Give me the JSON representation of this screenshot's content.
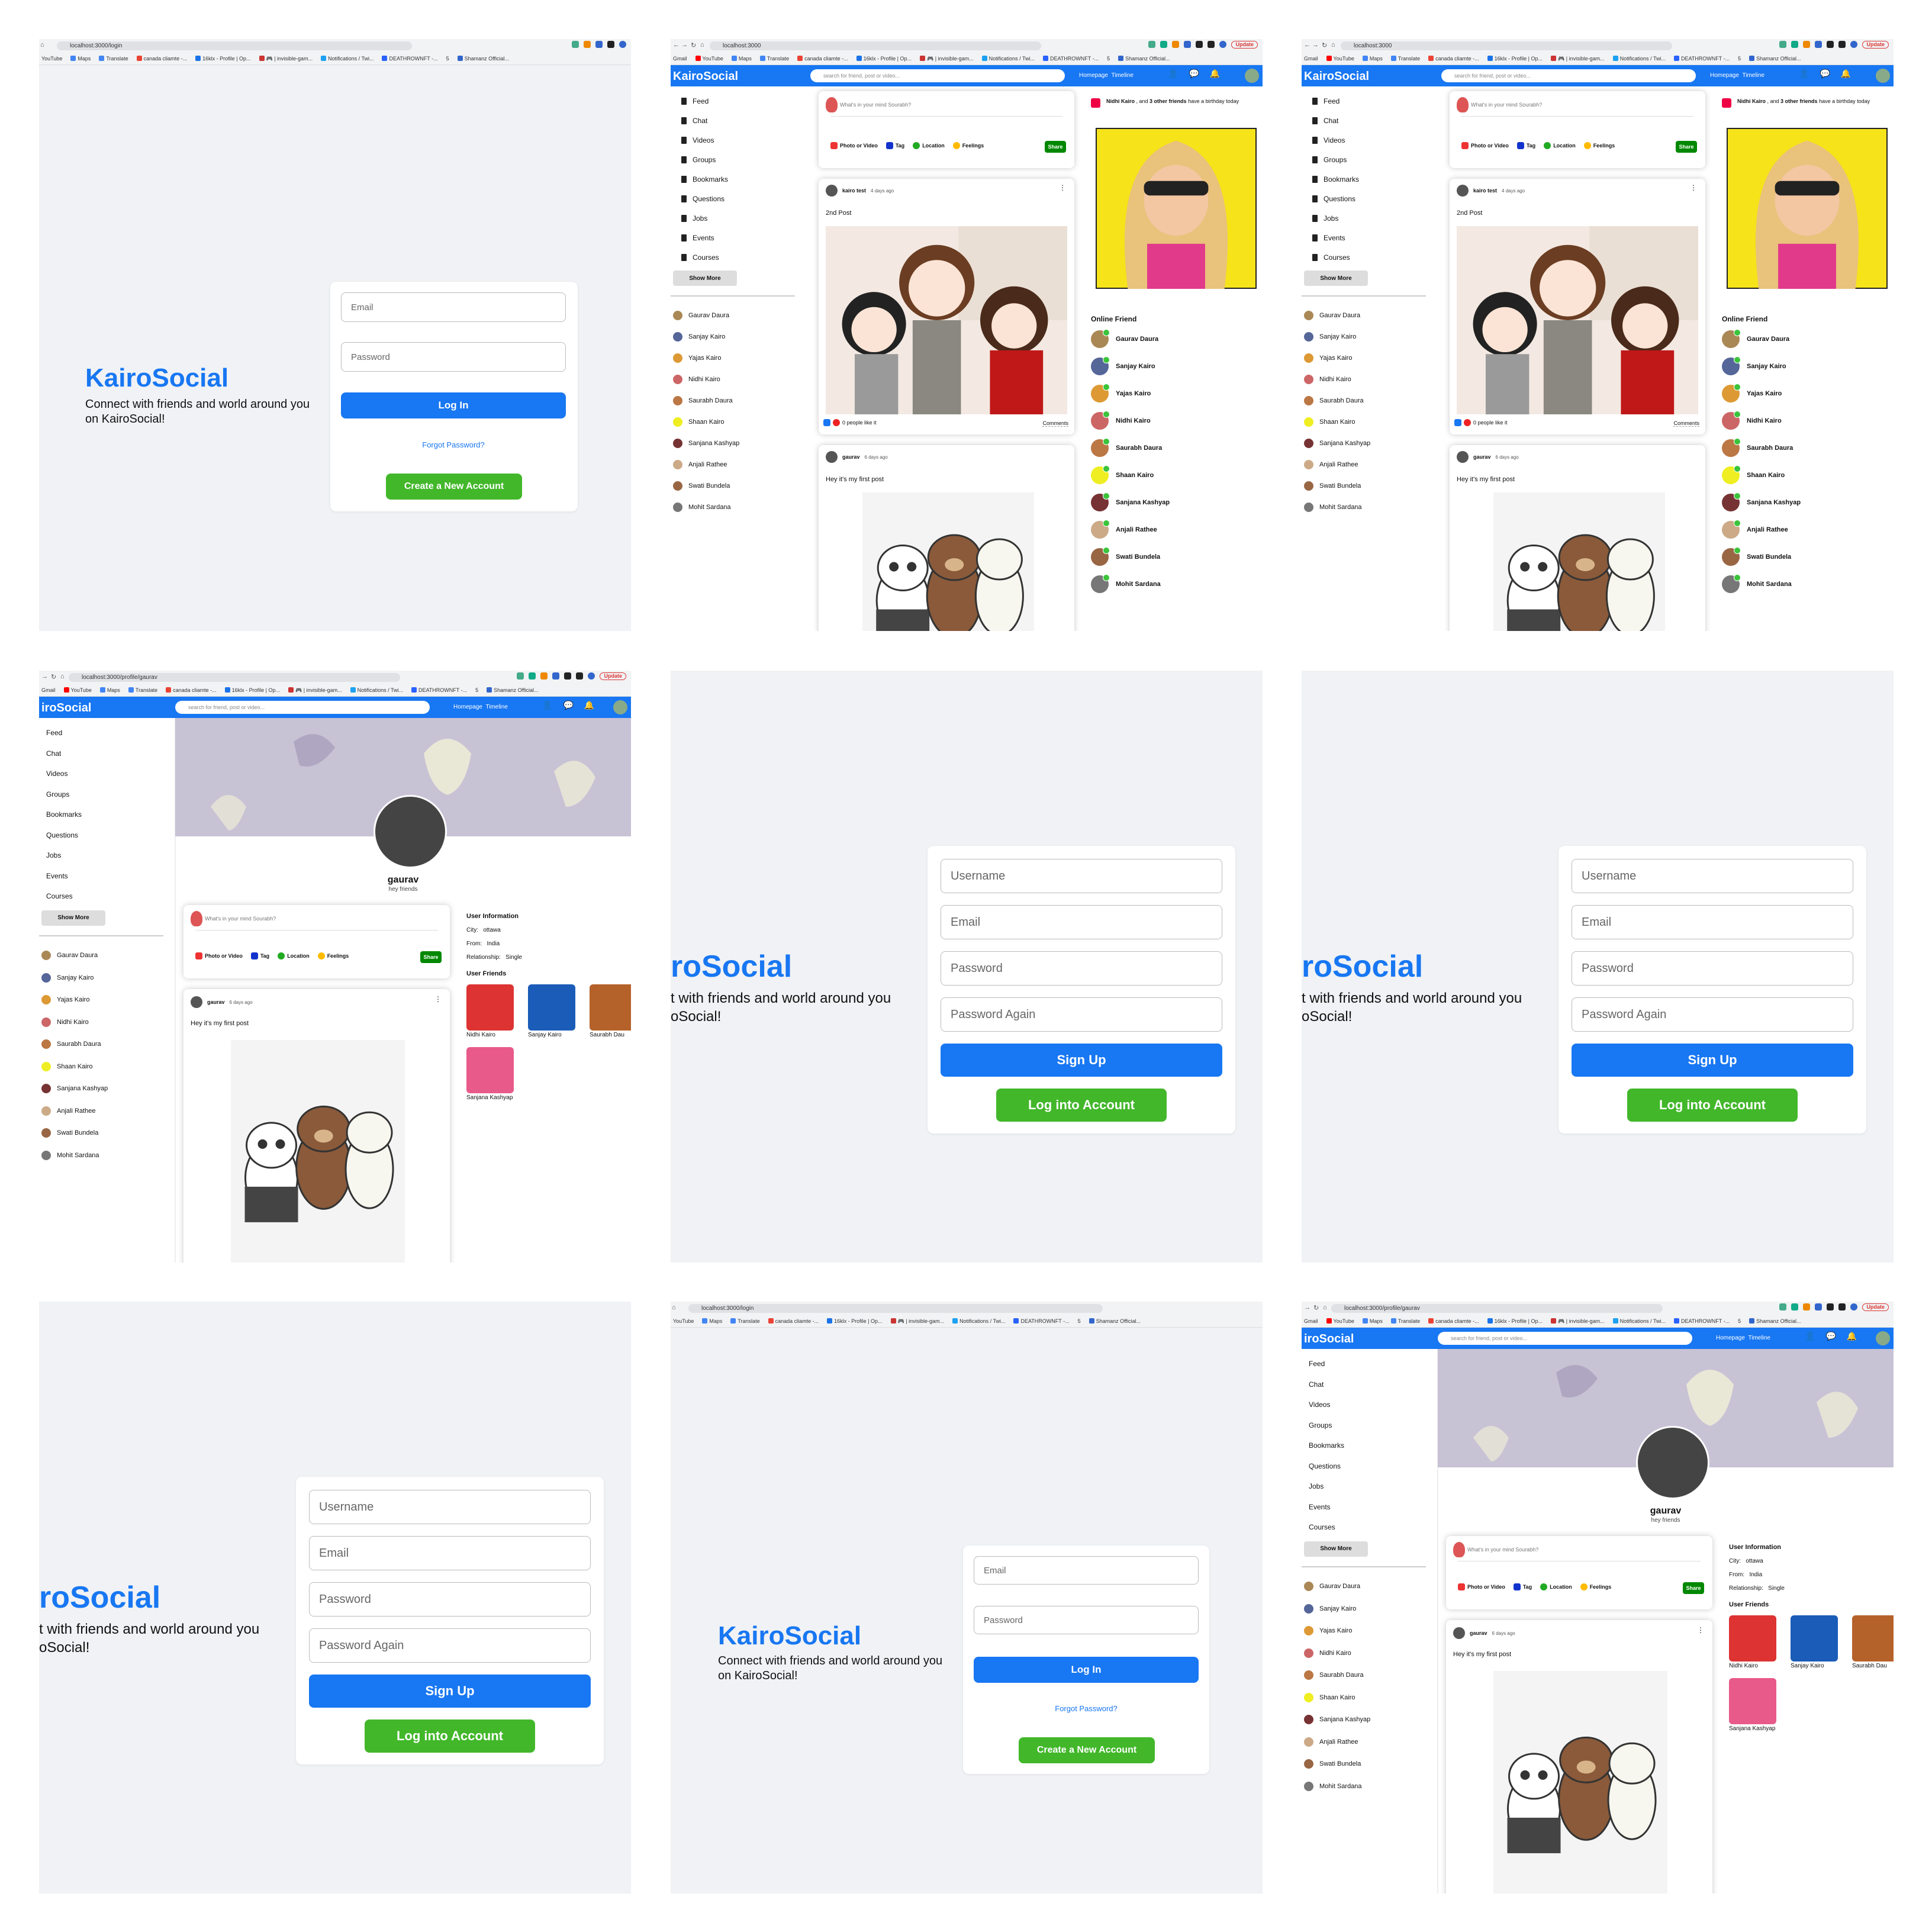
{
  "app": {
    "brand": "KairoSocial",
    "brand_cropped": "roSocial",
    "brand_cropped_topbar": "iroSocial",
    "tagline_l1": "Connect with friends and world around you",
    "tagline_l2": "on KairoSocial!",
    "tagline_cropped_l1": "t with friends and world around you",
    "tagline_cropped_l2": "oSocial!"
  },
  "browser": {
    "login_url": "localhost:3000/login",
    "home_url": "localhost:3000",
    "profile_url": "localhost:3000/profile/gaurav",
    "update": "Update",
    "bookmarks": [
      "Gmail",
      "YouTube",
      "Maps",
      "Translate",
      "canada cliamte -...",
      "16klx - Profile | Op...",
      "🎮 | invisible-gam...",
      "Notifications / Twi...",
      "DEATHROWNFT -...",
      "5",
      "Shamanz Official..."
    ]
  },
  "login": {
    "email_ph": "Email",
    "password_ph": "Password",
    "login_btn": "Log In",
    "forgot": "Forgot Password?",
    "create_btn": "Create a New Account"
  },
  "register": {
    "username_ph": "Username",
    "email_ph": "Email",
    "password_ph": "Password",
    "password_again_ph": "Password Again",
    "signup_btn": "Sign Up",
    "login_btn": "Log into Account"
  },
  "topbar": {
    "search_ph": "search for friend, post or video...",
    "homepage": "Homepage",
    "timeline": "Timeline",
    "badge1": "1",
    "badge2": "2",
    "badge3": "1"
  },
  "sidebar": {
    "items": [
      "Feed",
      "Chat",
      "Videos",
      "Groups",
      "Bookmarks",
      "Questions",
      "Jobs",
      "Events",
      "Courses"
    ],
    "show_more": "Show More",
    "friends": [
      "Gaurav Daura",
      "Sanjay Kairo",
      "Yajas Kairo",
      "Nidhi Kairo",
      "Saurabh Daura",
      "Shaan Kairo",
      "Sanjana Kashyap",
      "Anjali Rathee",
      "Swati Bundela",
      "Mohit Sardana"
    ]
  },
  "share": {
    "placeholder": "What's in your mind Sourabh?",
    "photo": "Photo or Video",
    "tag": "Tag",
    "location": "Location",
    "feelings": "Feelings",
    "share": "Share"
  },
  "posts": [
    {
      "user": "kairo test",
      "time": "4 days ago",
      "text": "2nd Post",
      "likes": "0 people like it",
      "comments": "Comments"
    },
    {
      "user": "gaurav",
      "time": "6 days ago",
      "text": "Hey it's my first post"
    }
  ],
  "rightbar": {
    "birthday_name": "Nidhi Kairo",
    "birthday_mid": " , and ",
    "birthday_bold": "3 other friends",
    "birthday_rest": " have a birthday today",
    "online_title": "Online Friend",
    "online": [
      "Gaurav Daura",
      "Sanjay Kairo",
      "Yajas Kairo",
      "Nidhi Kairo",
      "Saurabh Daura",
      "Shaan Kairo",
      "Sanjana Kashyap",
      "Anjali Rathee",
      "Swati Bundela",
      "Mohit Sardana"
    ]
  },
  "profile": {
    "name": "gaurav",
    "desc": "hey friends",
    "info_title": "User Information",
    "city_label": "City:",
    "city": "ottawa",
    "from_label": "From:",
    "from": "India",
    "rel_label": "Relationship:",
    "rel": "Single",
    "friends_title": "User Friends",
    "friends": [
      "Nidhi Kairo",
      "Sanjay Kairo",
      "Saurabh Dau",
      "Sanjana Kashyap"
    ]
  },
  "colors": {
    "blue": "#1877f2",
    "green": "#42b72a",
    "bg": "#f0f2f5"
  }
}
